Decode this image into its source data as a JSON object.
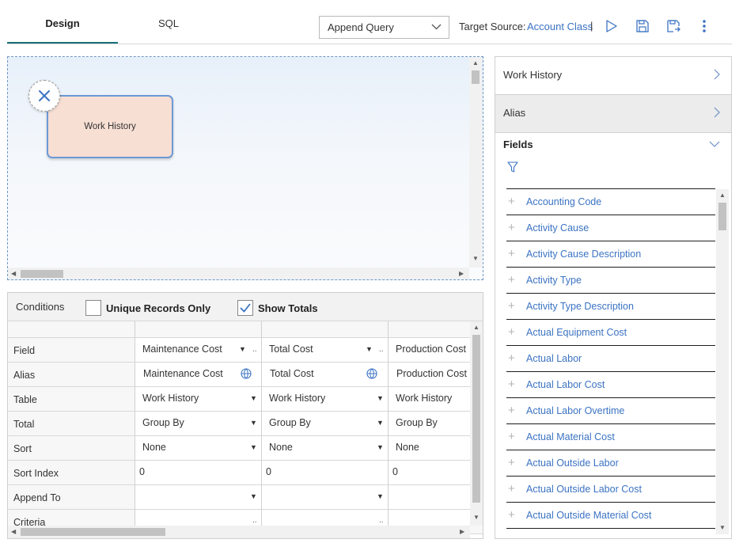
{
  "tabs": {
    "design": "Design",
    "sql": "SQL"
  },
  "toolbar": {
    "query_type": "Append Query",
    "target_source_label": "Target Source:",
    "target_source_value": "Account Class",
    "target_cursor": "|"
  },
  "canvas": {
    "node_label": "Work History"
  },
  "grid": {
    "conditions_label": "Conditions",
    "unique_records_label": "Unique Records Only",
    "unique_records_checked": false,
    "show_totals_label": "Show Totals",
    "show_totals_checked": true,
    "row_labels": [
      "Field",
      "Alias",
      "Table",
      "Total",
      "Sort",
      "Sort Index",
      "Append To",
      "Criteria"
    ],
    "columns": [
      {
        "field": "Maintenance Cost",
        "alias": "Maintenance Cost",
        "table": "Work History",
        "total": "Group By",
        "sort": "None",
        "sort_index": "0",
        "append_to": "",
        "criteria": ""
      },
      {
        "field": "Total Cost",
        "alias": "Total Cost",
        "table": "Work History",
        "total": "Group By",
        "sort": "None",
        "sort_index": "0",
        "append_to": "",
        "criteria": ""
      },
      {
        "field": "Production Cost",
        "alias": "Production Cost",
        "table": "Work History",
        "total": "Group By",
        "sort": "None",
        "sort_index": "0",
        "append_to": "",
        "criteria": ""
      }
    ]
  },
  "right_panel": {
    "source_title": "Work History",
    "alias_title": "Alias",
    "fields_title": "Fields",
    "fields": [
      "Accounting Code",
      "Activity Cause",
      "Activity Cause Description",
      "Activity Type",
      "Activity Type Description",
      "Actual Equipment Cost",
      "Actual Labor",
      "Actual Labor Cost",
      "Actual Labor Overtime",
      "Actual Material Cost",
      "Actual Outside Labor",
      "Actual Outside Labor Cost",
      "Actual Outside Material Cost"
    ]
  },
  "colors": {
    "accent": "#1a6f7a",
    "link": "#3b73c3",
    "node_fill": "#f7dfd4",
    "node_border": "#6d99d4"
  }
}
